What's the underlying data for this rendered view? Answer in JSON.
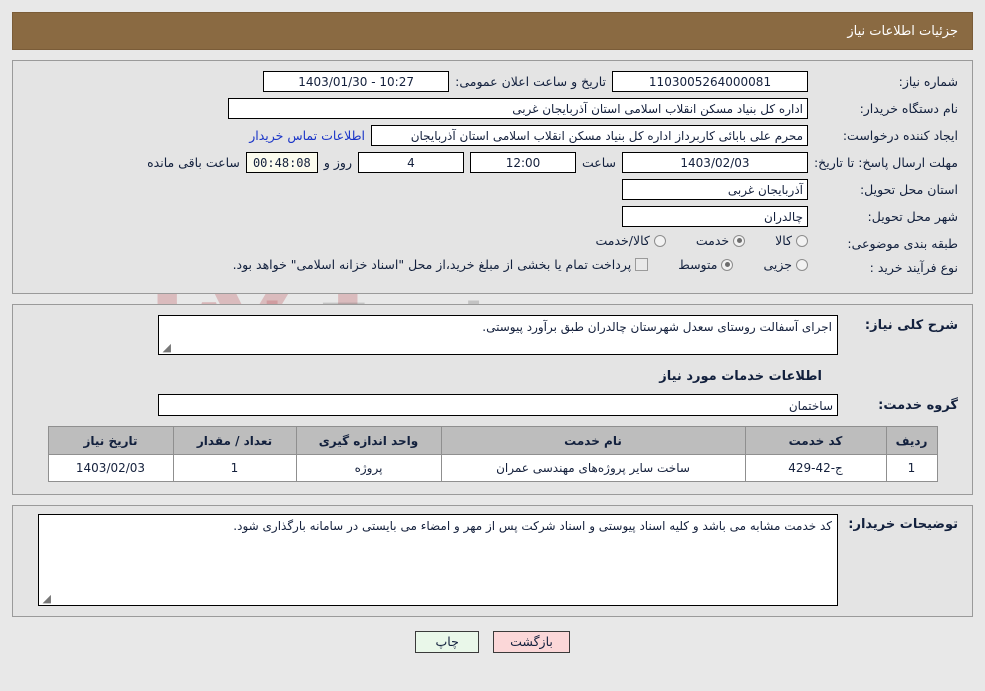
{
  "header": {
    "title": "جزئیات اطلاعات نیاز"
  },
  "watermark": {
    "text_left": "Aria",
    "text_right": "Tender.net",
    "shield_icon": "shield-icon"
  },
  "form": {
    "need_number": {
      "label": "شماره نیاز:",
      "value": "1103005264000081"
    },
    "public_announce": {
      "label": "تاریخ و ساعت اعلان عمومی:",
      "value": "1403/01/30 - 10:27"
    },
    "buyer_org": {
      "label": "نام دستگاه خریدار:",
      "value": "اداره کل بنیاد مسکن انقلاب اسلامی استان آذربایجان غربی"
    },
    "request_creator": {
      "label": "ایجاد کننده درخواست:",
      "value": "محرم علی بابائی کاربرداز اداره کل بنیاد مسکن انقلاب اسلامی استان آذربایجان",
      "contact_link": "اطلاعات تماس خریدار"
    },
    "deadline": {
      "label": "مهلت ارسال پاسخ: تا تاریخ:",
      "date": "1403/02/03",
      "hour_label": "ساعت",
      "hour": "12:00",
      "days": "4",
      "days_label": "روز و",
      "timer": "00:48:08",
      "timer_label": "ساعت باقی مانده"
    },
    "province": {
      "label": "استان محل تحویل:",
      "value": "آذربایجان غربی"
    },
    "city": {
      "label": "شهر محل تحویل:",
      "value": "چالدران"
    },
    "subject_class": {
      "label": "طبقه بندی موضوعی:",
      "options": [
        {
          "label": "کالا",
          "selected": false
        },
        {
          "label": "خدمت",
          "selected": true
        },
        {
          "label": "کالا/خدمت",
          "selected": false
        }
      ]
    },
    "purchase_process": {
      "label": "نوع فرآیند خرید :",
      "options": [
        {
          "label": "جزیی",
          "selected": false
        },
        {
          "label": "متوسط",
          "selected": true
        }
      ],
      "checkbox": {
        "checked": false,
        "text": "پرداخت تمام یا بخشی از مبلغ خرید،از محل \"اسناد خزانه اسلامی\" خواهد بود."
      }
    }
  },
  "description": {
    "label": "شرح کلی نیاز:",
    "value": "اجرای آسفالت روستای سعدل شهرستان چالدران طبق برآورد پیوستی."
  },
  "services_section": {
    "heading": "اطلاعات خدمات مورد نیاز",
    "group": {
      "label": "گروه خدمت:",
      "value": "ساختمان"
    }
  },
  "table": {
    "columns": [
      "ردیف",
      "کد خدمت",
      "نام خدمت",
      "واحد اندازه گیری",
      "تعداد / مقدار",
      "تاریخ نیاز"
    ],
    "rows": [
      {
        "row_no": "1",
        "service_code": "ج-42-429",
        "service_name": "ساخت سایر پروژه‌های مهندسی عمران",
        "unit": "پروژه",
        "quantity": "1",
        "need_date": "1403/02/03"
      }
    ]
  },
  "buyer_notes": {
    "label": "توضیحات خریدار:",
    "value": "کد خدمت مشابه می باشد و کلیه اسناد پیوستی و اسناد شرکت پس از مهر و امضاء می بایستی در سامانه بارگذاری شود."
  },
  "footer": {
    "print_button": "چاپ",
    "back_button": "بازگشت"
  },
  "colors": {
    "header_bar": "#8a6a42",
    "link": "#1a35c8",
    "print_button": "#e9f7e9",
    "back_button": "#fbd7d8",
    "timer_field": "#fbfbee",
    "table_header": "#bdbdbd"
  }
}
